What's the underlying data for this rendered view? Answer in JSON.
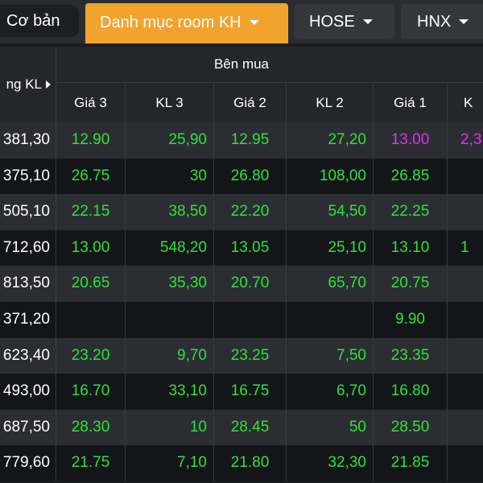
{
  "tabs": [
    {
      "label": "Cơ bản"
    },
    {
      "label": "Danh mục room KH"
    },
    {
      "label": "HOSE"
    },
    {
      "label": "HNX"
    }
  ],
  "table": {
    "left_header": "ng KL",
    "group_header": "Bên mua",
    "columns": [
      "Giá 3",
      "KL 3",
      "Giá 2",
      "KL 2",
      "Giá 1",
      "K"
    ],
    "rows": [
      {
        "total": "381,30",
        "g3": "12.90",
        "kl3": "25,90",
        "g2": "12.95",
        "kl2": "27,20",
        "g1": "13.00",
        "kl1": "2,3"
      },
      {
        "total": "375,10",
        "g3": "26.75",
        "kl3": "30",
        "g2": "26.80",
        "kl2": "108,00",
        "g1": "26.85",
        "kl1": ""
      },
      {
        "total": "505,10",
        "g3": "22.15",
        "kl3": "38,50",
        "g2": "22.20",
        "kl2": "54,50",
        "g1": "22.25",
        "kl1": ""
      },
      {
        "total": "712,60",
        "g3": "13.00",
        "kl3": "548,20",
        "g2": "13.05",
        "kl2": "25,10",
        "g1": "13.10",
        "kl1": "1"
      },
      {
        "total": "813,50",
        "g3": "20.65",
        "kl3": "35,30",
        "g2": "20.70",
        "kl2": "65,70",
        "g1": "20.75",
        "kl1": ""
      },
      {
        "total": "371,20",
        "g3": "",
        "kl3": "",
        "g2": "",
        "kl2": "",
        "g1": "9.90",
        "kl1": ""
      },
      {
        "total": "623,40",
        "g3": "23.20",
        "kl3": "9,70",
        "g2": "23.25",
        "kl2": "7,50",
        "g1": "23.35",
        "kl1": ""
      },
      {
        "total": "493,00",
        "g3": "16.70",
        "kl3": "33,10",
        "g2": "16.75",
        "kl2": "6,70",
        "g1": "16.80",
        "kl1": ""
      },
      {
        "total": "687,50",
        "g3": "28.30",
        "kl3": "10",
        "g2": "28.45",
        "kl2": "50",
        "g1": "28.50",
        "kl1": ""
      },
      {
        "total": "779,60",
        "g3": "21.75",
        "kl3": "7,10",
        "g2": "21.80",
        "kl2": "32,30",
        "g1": "21.85",
        "kl1": ""
      }
    ]
  },
  "colors": {
    "accent_tab": "#f0a42e",
    "price_up": "#2ee23a",
    "ceiling": "#e232e8"
  }
}
